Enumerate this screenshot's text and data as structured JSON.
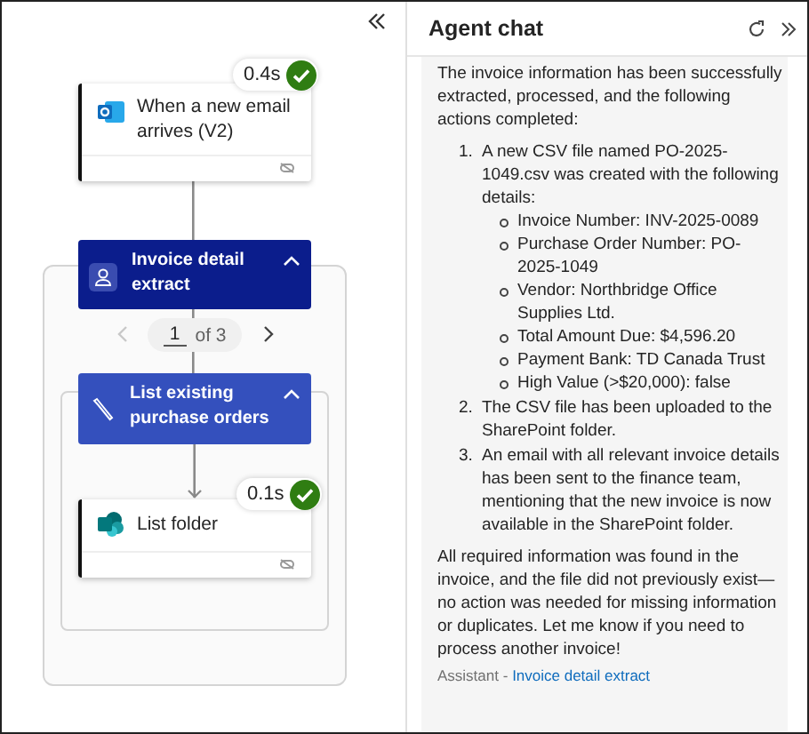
{
  "flow": {
    "trigger": {
      "title": "When a new email arrives (V2)",
      "duration": "0.4s",
      "succeeded": true
    },
    "agent": {
      "title": "Invoice detail extract",
      "expanded": true,
      "pager": {
        "value": "1",
        "total": "of 3",
        "prev_disabled": true
      }
    },
    "tool": {
      "title": "List existing purchase orders",
      "expanded": true
    },
    "action": {
      "title": "List folder",
      "duration": "0.1s",
      "succeeded": true
    }
  },
  "chat": {
    "title": "Agent chat",
    "message": {
      "intro": "The invoice information has been successfully extracted, processed, and the following actions completed:",
      "steps": [
        {
          "number": "1.",
          "text": "A new CSV file named PO-2025-1049.csv was created with the following details:",
          "details": [
            "Invoice Number: INV-2025-0089",
            "Purchase Order Number: PO-2025-1049",
            "Vendor: Northbridge Office Supplies Ltd.",
            "Total Amount Due: $4,596.20",
            "Payment Bank: TD Canada Trust",
            "High Value (>$20,000): false"
          ]
        },
        {
          "number": "2.",
          "text": "The CSV file has been uploaded to the SharePoint folder."
        },
        {
          "number": "3.",
          "text": "An email with all relevant invoice details has been sent to the finance team, mentioning that the new invoice is now available in the SharePoint folder."
        }
      ],
      "closing": "All required information was found in the invoice, and the file did not previously exist—no action was needed for missing information or duplicates. Let me know if you need to process another invoice!",
      "sender": "Assistant -",
      "source_link": "Invoice detail extract"
    }
  }
}
